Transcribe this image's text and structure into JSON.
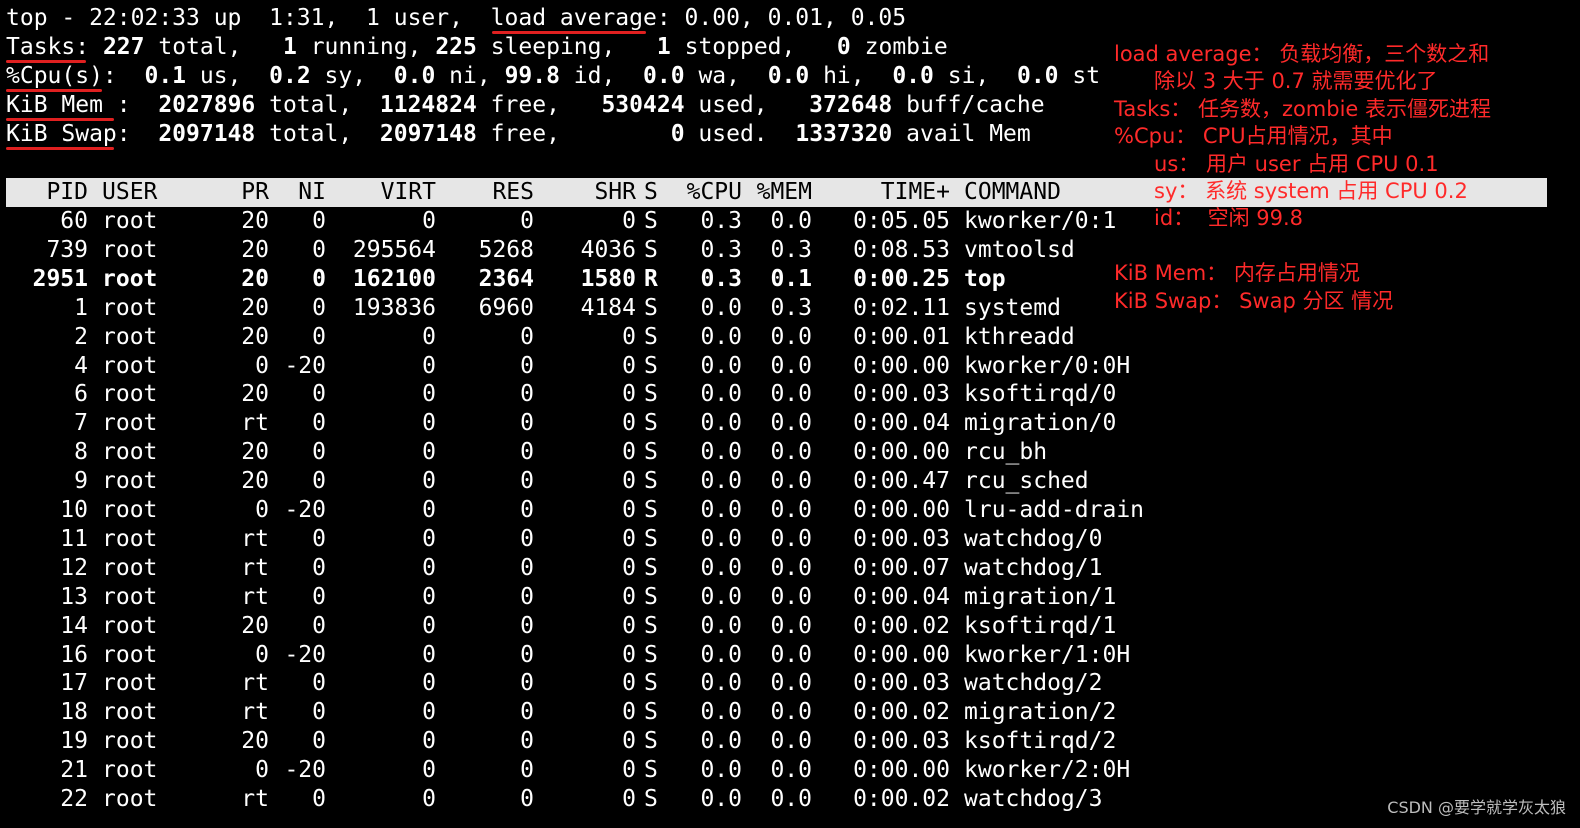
{
  "summary": {
    "line1_a": "top - 22:02:33 up  1:31,  1 user,  ",
    "line1_b": "load average",
    "line1_c": ": 0.00, 0.01, 0.05",
    "tasks_label": "Tasks:",
    "tasks_total": "227",
    "tasks_total_lbl": " total,   ",
    "tasks_running": "1",
    "tasks_running_lbl": " running, ",
    "tasks_sleeping": "225",
    "tasks_sleeping_lbl": " sleeping,   ",
    "tasks_stopped": "1",
    "tasks_stopped_lbl": " stopped,   ",
    "tasks_zombie": "0",
    "tasks_zombie_lbl": " zombie",
    "cpu_label": "%Cpu(s):",
    "cpu_us": "0.1",
    "cpu_us_lbl": " us,  ",
    "cpu_sy": "0.2",
    "cpu_sy_lbl": " sy,  ",
    "cpu_ni": "0.0",
    "cpu_ni_lbl": " ni, ",
    "cpu_id": "99.8",
    "cpu_id_lbl": " id,  ",
    "cpu_wa": "0.0",
    "cpu_wa_lbl": " wa,  ",
    "cpu_hi": "0.0",
    "cpu_hi_lbl": " hi,  ",
    "cpu_si": "0.0",
    "cpu_si_lbl": " si,  ",
    "cpu_st": "0.0",
    "cpu_st_lbl": " st",
    "mem_label": "KiB Mem :",
    "mem_total": "2027896",
    "mem_total_lbl": " total,  ",
    "mem_free": "1124824",
    "mem_free_lbl": " free,   ",
    "mem_used": "530424",
    "mem_used_lbl": " used,   ",
    "mem_buff": "372648",
    "mem_buff_lbl": " buff/cache",
    "swap_label": "KiB Swap:",
    "swap_total": "2097148",
    "swap_total_lbl": " total,  ",
    "swap_free": "2097148",
    "swap_free_lbl": " free,        ",
    "swap_used": "0",
    "swap_used_lbl": " used.  ",
    "swap_avail": "1337320",
    "swap_avail_lbl": " avail Mem"
  },
  "columns": [
    "PID",
    "USER",
    "PR",
    "NI",
    "VIRT",
    "RES",
    "SHR",
    "S",
    "%CPU",
    "%MEM",
    "TIME+",
    "COMMAND"
  ],
  "processes": [
    [
      "60",
      "root",
      "20",
      "0",
      "0",
      "0",
      "0",
      "S",
      "0.3",
      "0.0",
      "0:05.05",
      "kworker/0:1"
    ],
    [
      "739",
      "root",
      "20",
      "0",
      "295564",
      "5268",
      "4036",
      "S",
      "0.3",
      "0.3",
      "0:08.53",
      "vmtoolsd"
    ],
    [
      "2951",
      "root",
      "20",
      "0",
      "162100",
      "2364",
      "1580",
      "R",
      "0.3",
      "0.1",
      "0:00.25",
      "top"
    ],
    [
      "1",
      "root",
      "20",
      "0",
      "193836",
      "6960",
      "4184",
      "S",
      "0.0",
      "0.3",
      "0:02.11",
      "systemd"
    ],
    [
      "2",
      "root",
      "20",
      "0",
      "0",
      "0",
      "0",
      "S",
      "0.0",
      "0.0",
      "0:00.01",
      "kthreadd"
    ],
    [
      "4",
      "root",
      "0",
      "-20",
      "0",
      "0",
      "0",
      "S",
      "0.0",
      "0.0",
      "0:00.00",
      "kworker/0:0H"
    ],
    [
      "6",
      "root",
      "20",
      "0",
      "0",
      "0",
      "0",
      "S",
      "0.0",
      "0.0",
      "0:00.03",
      "ksoftirqd/0"
    ],
    [
      "7",
      "root",
      "rt",
      "0",
      "0",
      "0",
      "0",
      "S",
      "0.0",
      "0.0",
      "0:00.04",
      "migration/0"
    ],
    [
      "8",
      "root",
      "20",
      "0",
      "0",
      "0",
      "0",
      "S",
      "0.0",
      "0.0",
      "0:00.00",
      "rcu_bh"
    ],
    [
      "9",
      "root",
      "20",
      "0",
      "0",
      "0",
      "0",
      "S",
      "0.0",
      "0.0",
      "0:00.47",
      "rcu_sched"
    ],
    [
      "10",
      "root",
      "0",
      "-20",
      "0",
      "0",
      "0",
      "S",
      "0.0",
      "0.0",
      "0:00.00",
      "lru-add-drain"
    ],
    [
      "11",
      "root",
      "rt",
      "0",
      "0",
      "0",
      "0",
      "S",
      "0.0",
      "0.0",
      "0:00.03",
      "watchdog/0"
    ],
    [
      "12",
      "root",
      "rt",
      "0",
      "0",
      "0",
      "0",
      "S",
      "0.0",
      "0.0",
      "0:00.07",
      "watchdog/1"
    ],
    [
      "13",
      "root",
      "rt",
      "0",
      "0",
      "0",
      "0",
      "S",
      "0.0",
      "0.0",
      "0:00.04",
      "migration/1"
    ],
    [
      "14",
      "root",
      "20",
      "0",
      "0",
      "0",
      "0",
      "S",
      "0.0",
      "0.0",
      "0:00.02",
      "ksoftirqd/1"
    ],
    [
      "16",
      "root",
      "0",
      "-20",
      "0",
      "0",
      "0",
      "S",
      "0.0",
      "0.0",
      "0:00.00",
      "kworker/1:0H"
    ],
    [
      "17",
      "root",
      "rt",
      "0",
      "0",
      "0",
      "0",
      "S",
      "0.0",
      "0.0",
      "0:00.03",
      "watchdog/2"
    ],
    [
      "18",
      "root",
      "rt",
      "0",
      "0",
      "0",
      "0",
      "S",
      "0.0",
      "0.0",
      "0:00.02",
      "migration/2"
    ],
    [
      "19",
      "root",
      "20",
      "0",
      "0",
      "0",
      "0",
      "S",
      "0.0",
      "0.0",
      "0:00.03",
      "ksoftirqd/2"
    ],
    [
      "21",
      "root",
      "0",
      "-20",
      "0",
      "0",
      "0",
      "S",
      "0.0",
      "0.0",
      "0:00.00",
      "kworker/2:0H"
    ],
    [
      "22",
      "root",
      "rt",
      "0",
      "0",
      "0",
      "0",
      "S",
      "0.0",
      "0.0",
      "0:00.02",
      "watchdog/3"
    ]
  ],
  "bold_pid": "2951",
  "annotations": [
    "load average： 负载均衡，三个数之和",
    "      除以 3 大于 0.7 就需要优化了",
    "Tasks： 任务数，zombie 表示僵死进程",
    "%Cpu： CPU占用情况，其中",
    "      us： 用户 user 占用 CPU 0.1",
    "      sy： 系统 system 占用 CPU 0.2",
    "      id：  空闲 99.8",
    "KiB Mem： 内存占用情况",
    "KiB Swap： Swap 分区 情况"
  ],
  "watermark": "CSDN @要学就学灰太狼",
  "colors": {
    "annotation": "#ff2a2a",
    "header_bar": "#e6e6e6",
    "underline": "#e02020"
  }
}
